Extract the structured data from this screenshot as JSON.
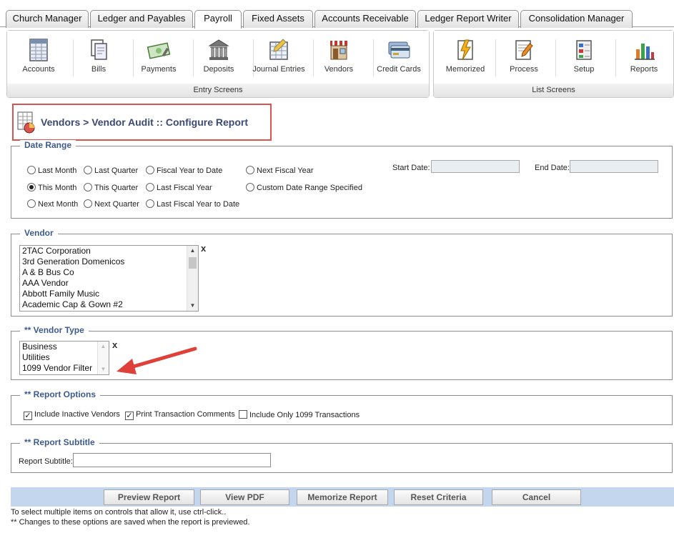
{
  "tabs": [
    {
      "label": "Church Manager"
    },
    {
      "label": "Ledger and Payables"
    },
    {
      "label": "Payroll"
    },
    {
      "label": "Fixed Assets"
    },
    {
      "label": "Accounts Receivable"
    },
    {
      "label": "Ledger Report Writer"
    },
    {
      "label": "Consolidation Manager"
    }
  ],
  "ribbon": {
    "entry_group_label": "Entry Screens",
    "list_group_label": "List Screens",
    "entry_items": [
      {
        "label": "Accounts",
        "icon": "accounts-ledger-icon"
      },
      {
        "label": "Bills",
        "icon": "bills-icon"
      },
      {
        "label": "Payments",
        "icon": "payments-icon"
      },
      {
        "label": "Deposits",
        "icon": "bank-deposits-icon"
      },
      {
        "label": "Journal Entries",
        "icon": "journal-entries-icon"
      },
      {
        "label": "Vendors",
        "icon": "vendor-store-icon"
      },
      {
        "label": "Credit Cards",
        "icon": "credit-card-icon"
      }
    ],
    "list_items": [
      {
        "label": "Memorized",
        "icon": "memorized-icon"
      },
      {
        "label": "Process",
        "icon": "process-icon"
      },
      {
        "label": "Setup",
        "icon": "setup-icon"
      },
      {
        "label": "Reports",
        "icon": "reports-chart-icon"
      }
    ]
  },
  "page_title": "Vendors > Vendor Audit :: Configure Report",
  "date_range": {
    "legend": "Date Range",
    "options": [
      {
        "label": "Last Month",
        "checked": false
      },
      {
        "label": "Last Quarter",
        "checked": false
      },
      {
        "label": "Fiscal Year to Date",
        "checked": false
      },
      {
        "label": "Next Fiscal Year",
        "checked": false
      },
      {
        "label": "This Month",
        "checked": true
      },
      {
        "label": "This Quarter",
        "checked": false
      },
      {
        "label": "Last Fiscal Year",
        "checked": false
      },
      {
        "label": "Custom Date Range Specified",
        "checked": false
      },
      {
        "label": "Next Month",
        "checked": false
      },
      {
        "label": "Next Quarter",
        "checked": false
      },
      {
        "label": "Last Fiscal Year to Date",
        "checked": false
      }
    ],
    "start_date_label": "Start Date:",
    "start_date_value": "",
    "end_date_label": "End Date:",
    "end_date_value": ""
  },
  "vendor": {
    "legend": "Vendor",
    "items": [
      "2TAC Corporation",
      "3rd Generation Domenicos",
      "A & B Bus Co",
      "AAA Vendor",
      "Abbott Family Music",
      "Academic Cap & Gown #2"
    ],
    "clear_label": "x"
  },
  "vendor_type": {
    "legend": "** Vendor Type",
    "items": [
      "Business",
      "Utilities",
      "1099 Vendor Filter"
    ],
    "clear_label": "x"
  },
  "report_options": {
    "legend": "** Report Options",
    "checkboxes": [
      {
        "label": "Include Inactive Vendors",
        "checked": true
      },
      {
        "label": "Print Transaction Comments",
        "checked": true
      },
      {
        "label": "Include Only 1099 Transactions",
        "checked": false
      }
    ]
  },
  "report_subtitle": {
    "legend": "** Report Subtitle",
    "label": "Report Subtitle:",
    "value": ""
  },
  "buttons": {
    "preview": "Preview Report",
    "view_pdf": "View PDF",
    "memorize": "Memorize Report",
    "reset": "Reset Criteria",
    "cancel": "Cancel"
  },
  "notes": {
    "line1": "To select multiple items on controls that allow it, use ctrl-click..",
    "line2": "** Changes to these options are saved when the report is previewed."
  },
  "colors": {
    "title_box_border": "#d9534f",
    "legend_text": "#3d5a8e",
    "title_text": "#3c4a72",
    "button_bar": "#c4d6ee",
    "arrow": "#e0403a"
  }
}
